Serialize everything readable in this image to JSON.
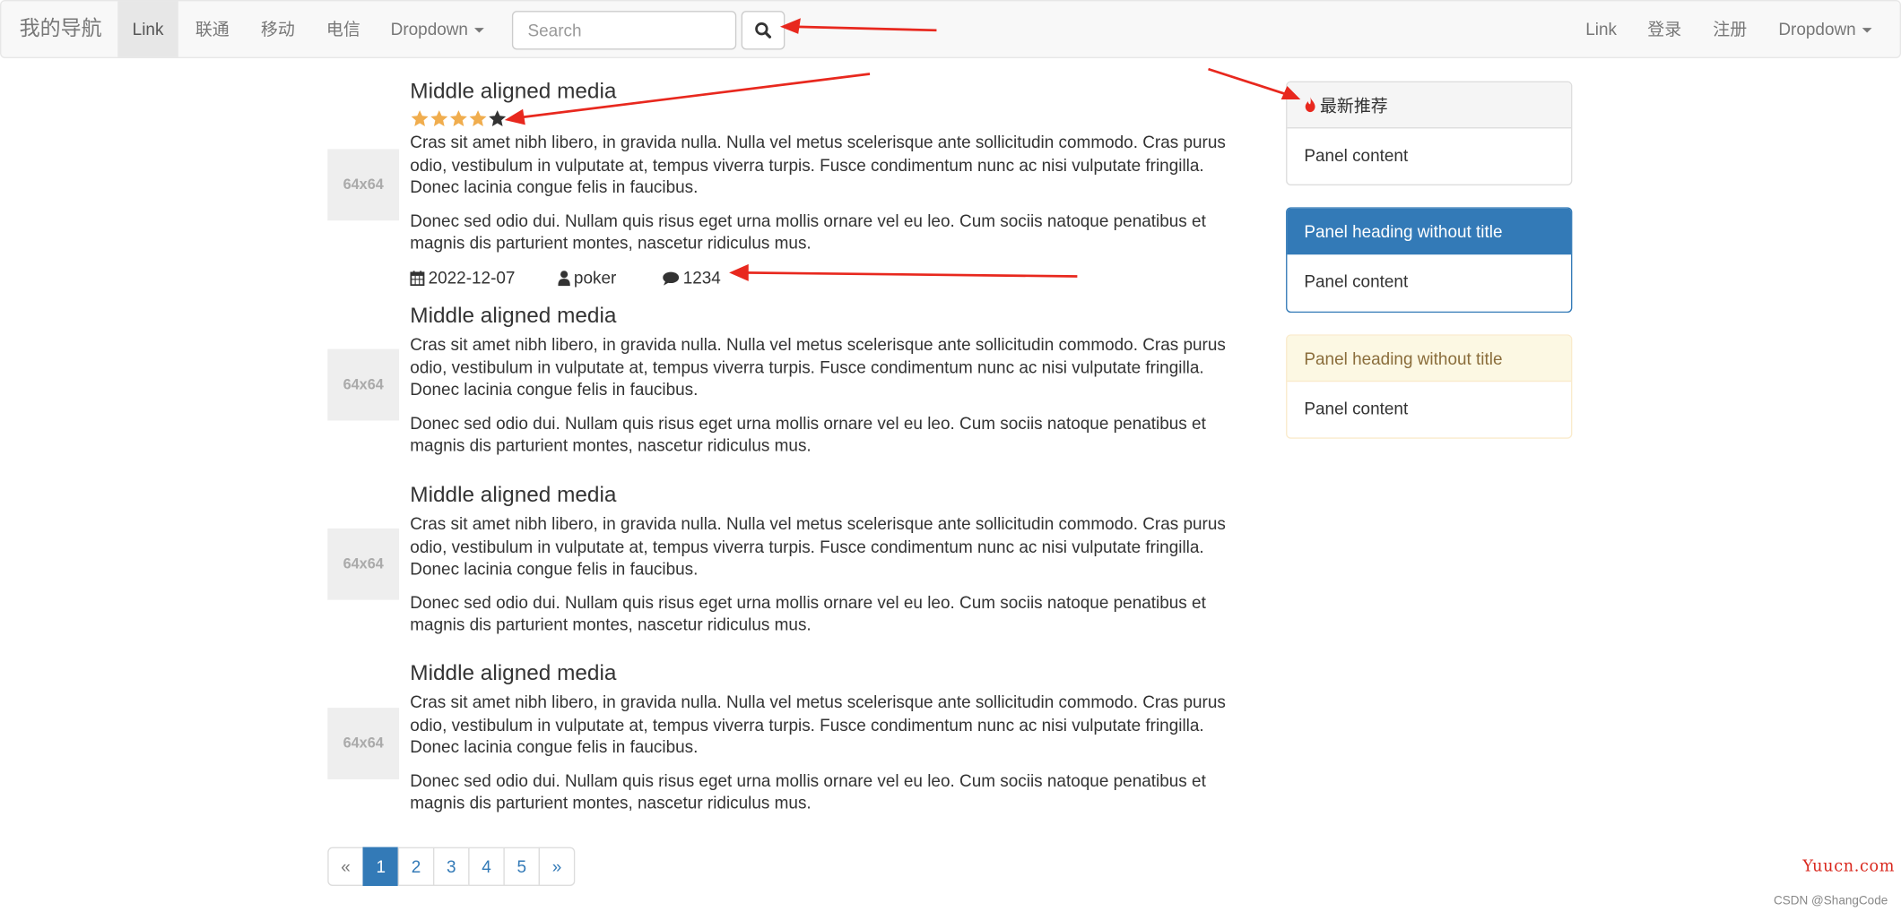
{
  "navbar": {
    "brand": "我的导航",
    "left_links": [
      {
        "label": "Link",
        "active": true
      },
      {
        "label": "联通"
      },
      {
        "label": "移动"
      },
      {
        "label": "电信"
      },
      {
        "label": "Dropdown"
      }
    ],
    "search": {
      "placeholder": "Search"
    },
    "right_links": [
      {
        "label": "Link"
      },
      {
        "label": "登录"
      },
      {
        "label": "注册"
      },
      {
        "label": "Dropdown"
      }
    ]
  },
  "media_items": [
    {
      "thumb": "64x64",
      "heading": "Middle aligned media",
      "rating": {
        "value": 4,
        "max": 5
      },
      "p1": "Cras sit amet nibh libero, in gravida nulla. Nulla vel metus scelerisque ante sollicitudin commodo. Cras purus odio, vestibulum in vulputate at, tempus viverra turpis. Fusce condimentum nunc ac nisi vulputate fringilla. Donec lacinia congue felis in faucibus.",
      "p2": "Donec sed odio dui. Nullam quis risus eget urna mollis ornare vel eu leo. Cum sociis natoque penatibus et magnis dis parturient montes, nascetur ridiculus mus.",
      "meta": {
        "date": "2022-12-07",
        "author": "poker",
        "comments": "1234"
      }
    },
    {
      "thumb": "64x64",
      "heading": "Middle aligned media",
      "p1": "Cras sit amet nibh libero, in gravida nulla. Nulla vel metus scelerisque ante sollicitudin commodo. Cras purus odio, vestibulum in vulputate at, tempus viverra turpis. Fusce condimentum nunc ac nisi vulputate fringilla. Donec lacinia congue felis in faucibus.",
      "p2": "Donec sed odio dui. Nullam quis risus eget urna mollis ornare vel eu leo. Cum sociis natoque penatibus et magnis dis parturient montes, nascetur ridiculus mus."
    },
    {
      "thumb": "64x64",
      "heading": "Middle aligned media",
      "p1": "Cras sit amet nibh libero, in gravida nulla. Nulla vel metus scelerisque ante sollicitudin commodo. Cras purus odio, vestibulum in vulputate at, tempus viverra turpis. Fusce condimentum nunc ac nisi vulputate fringilla. Donec lacinia congue felis in faucibus.",
      "p2": "Donec sed odio dui. Nullam quis risus eget urna mollis ornare vel eu leo. Cum sociis natoque penatibus et magnis dis parturient montes, nascetur ridiculus mus."
    },
    {
      "thumb": "64x64",
      "heading": "Middle aligned media",
      "p1": "Cras sit amet nibh libero, in gravida nulla. Nulla vel metus scelerisque ante sollicitudin commodo. Cras purus odio, vestibulum in vulputate at, tempus viverra turpis. Fusce condimentum nunc ac nisi vulputate fringilla. Donec lacinia congue felis in faucibus.",
      "p2": "Donec sed odio dui. Nullam quis risus eget urna mollis ornare vel eu leo. Cum sociis natoque penatibus et magnis dis parturient montes, nascetur ridiculus mus."
    }
  ],
  "panels": [
    {
      "heading": "最新推荐",
      "icon": "fire-icon",
      "content": "Panel content"
    },
    {
      "heading": "Panel heading without title",
      "content": "Panel content"
    },
    {
      "heading": "Panel heading without title",
      "content": "Panel content"
    }
  ],
  "pagination": {
    "prev": "«",
    "pages": [
      "1",
      "2",
      "3",
      "4",
      "5"
    ],
    "active_page": "1",
    "next": "»"
  },
  "watermark": {
    "site": "Yuucn.com",
    "credit": "CSDN @ShangCode"
  },
  "colors": {
    "primary": "#337ab7",
    "star_filled": "#f0ad4e",
    "star_empty": "#333333",
    "fire": "#e8281e",
    "annotation_arrow": "#e8281e",
    "warning_bg": "#fcf8e3"
  }
}
